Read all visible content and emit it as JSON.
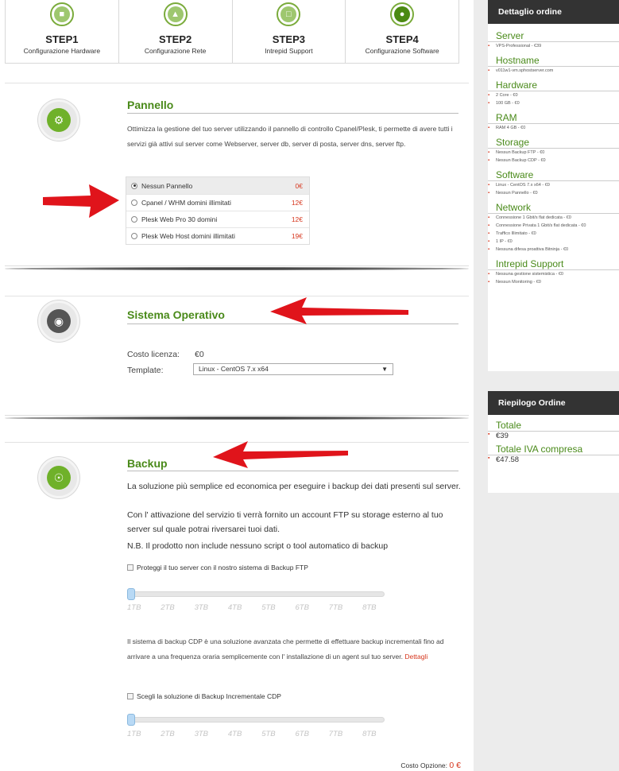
{
  "steps": [
    {
      "num": "STEP1",
      "name": "Configurazione Hardware",
      "icon": "chip-icon"
    },
    {
      "num": "STEP2",
      "name": "Configurazione Rete",
      "icon": "network-icon"
    },
    {
      "num": "STEP3",
      "name": "Intrepid Support",
      "icon": "support-icon"
    },
    {
      "num": "STEP4",
      "name": "Configurazione Software",
      "icon": "software-icon"
    }
  ],
  "pannello": {
    "title": "Pannello",
    "description": "Ottimizza la gestione del tuo server utilizzando il pannello di controllo Cpanel/Plesk, ti permette di avere tutti i servizi già attivi sul server come Webserver, server db, server di posta, server dns, server ftp.",
    "options": [
      {
        "label": "Nessun Pannello",
        "price": "0€",
        "selected": true
      },
      {
        "label": "Cpanel / WHM domini illimitati",
        "price": "12€",
        "selected": false
      },
      {
        "label": "Plesk Web Pro 30 domini",
        "price": "12€",
        "selected": false
      },
      {
        "label": "Plesk Web Host domini illimitati",
        "price": "19€",
        "selected": false
      }
    ]
  },
  "sistema": {
    "title": "Sistema Operativo",
    "costo_label": "Costo licenza:",
    "costo_value": "€0",
    "template_label": "Template:",
    "template_value": "Linux - CentOS 7.x x64"
  },
  "backup": {
    "title": "Backup",
    "p1": "La soluzione più semplice ed economica per eseguire i backup dei dati presenti sul server.",
    "p2": "Con l' attivazione del servizio ti verrà fornito un account FTP su storage esterno al tuo server sul quale potrai riversarei tuoi dati.",
    "p3": "N.B. Il prodotto non include nessuno script o tool automatico di backup",
    "ftp_checkbox": "Proteggi il tuo server con il nostro sistema di Backup FTP",
    "ticks": [
      "1TB",
      "2TB",
      "3TB",
      "4TB",
      "5TB",
      "6TB",
      "7TB",
      "8TB"
    ],
    "cdp_text": "Il sistema di backup CDP è una soluzione avanzata che permette di effettuare backup incrementali fino ad arrivare a una frequenza oraria semplicemente con l' installazione di un agent sul tuo server.",
    "dettagli": "Dettagli",
    "cdp_checkbox": "Scegli la soluzione di Backup Incrementale CDP",
    "costo_label": "Costo Opzione:",
    "costo_value": "0 €"
  },
  "sidebar": {
    "header": "Dettaglio ordine",
    "server_label": "Server",
    "server_items": [
      "VPS-Professional - €39"
    ],
    "hostname_label": "Hostname",
    "hostname_items": [
      "v011w1-vm.sphostserver.com"
    ],
    "hardware_label": "Hardware",
    "hardware_items": [
      "2 Core - €0",
      "100 GB - €0"
    ],
    "ram_label": "RAM",
    "ram_items": [
      "RAM 4 GB - €0"
    ],
    "storage_label": "Storage",
    "storage_items": [
      "Nessun Backup FTP - €0",
      "Nessun Backup CDP - €0"
    ],
    "software_label": "Software",
    "software_items": [
      "Linux - CentOS 7.x x64 - €0",
      "Nessun Pannello - €0"
    ],
    "network_label": "Network",
    "network_items": [
      "Connessione 1 Gbit/s flat dedicata - €0",
      "Connessione Privata 1 Gbit/s flat dedicata - €0",
      "Traffico Illimitato - €0",
      "1 IP - €0",
      "Nessuna difesa proattiva Bitninja - €0"
    ],
    "support_label": "Intrepid Support",
    "support_items": [
      "Nessuna gestione sistemistica - €0",
      "Nessun Monitoring - €0"
    ]
  },
  "riepilogo": {
    "header": "Riepilogo Ordine",
    "totale_label": "Totale",
    "totale_value": "€39",
    "iva_label": "Totale IVA compresa",
    "iva_value": "€47.58"
  },
  "colors": {
    "accent_green": "#4a8a1a",
    "price_red": "#d6361d",
    "arrow_red": "#e0141b",
    "sidebar_header": "#333333"
  }
}
